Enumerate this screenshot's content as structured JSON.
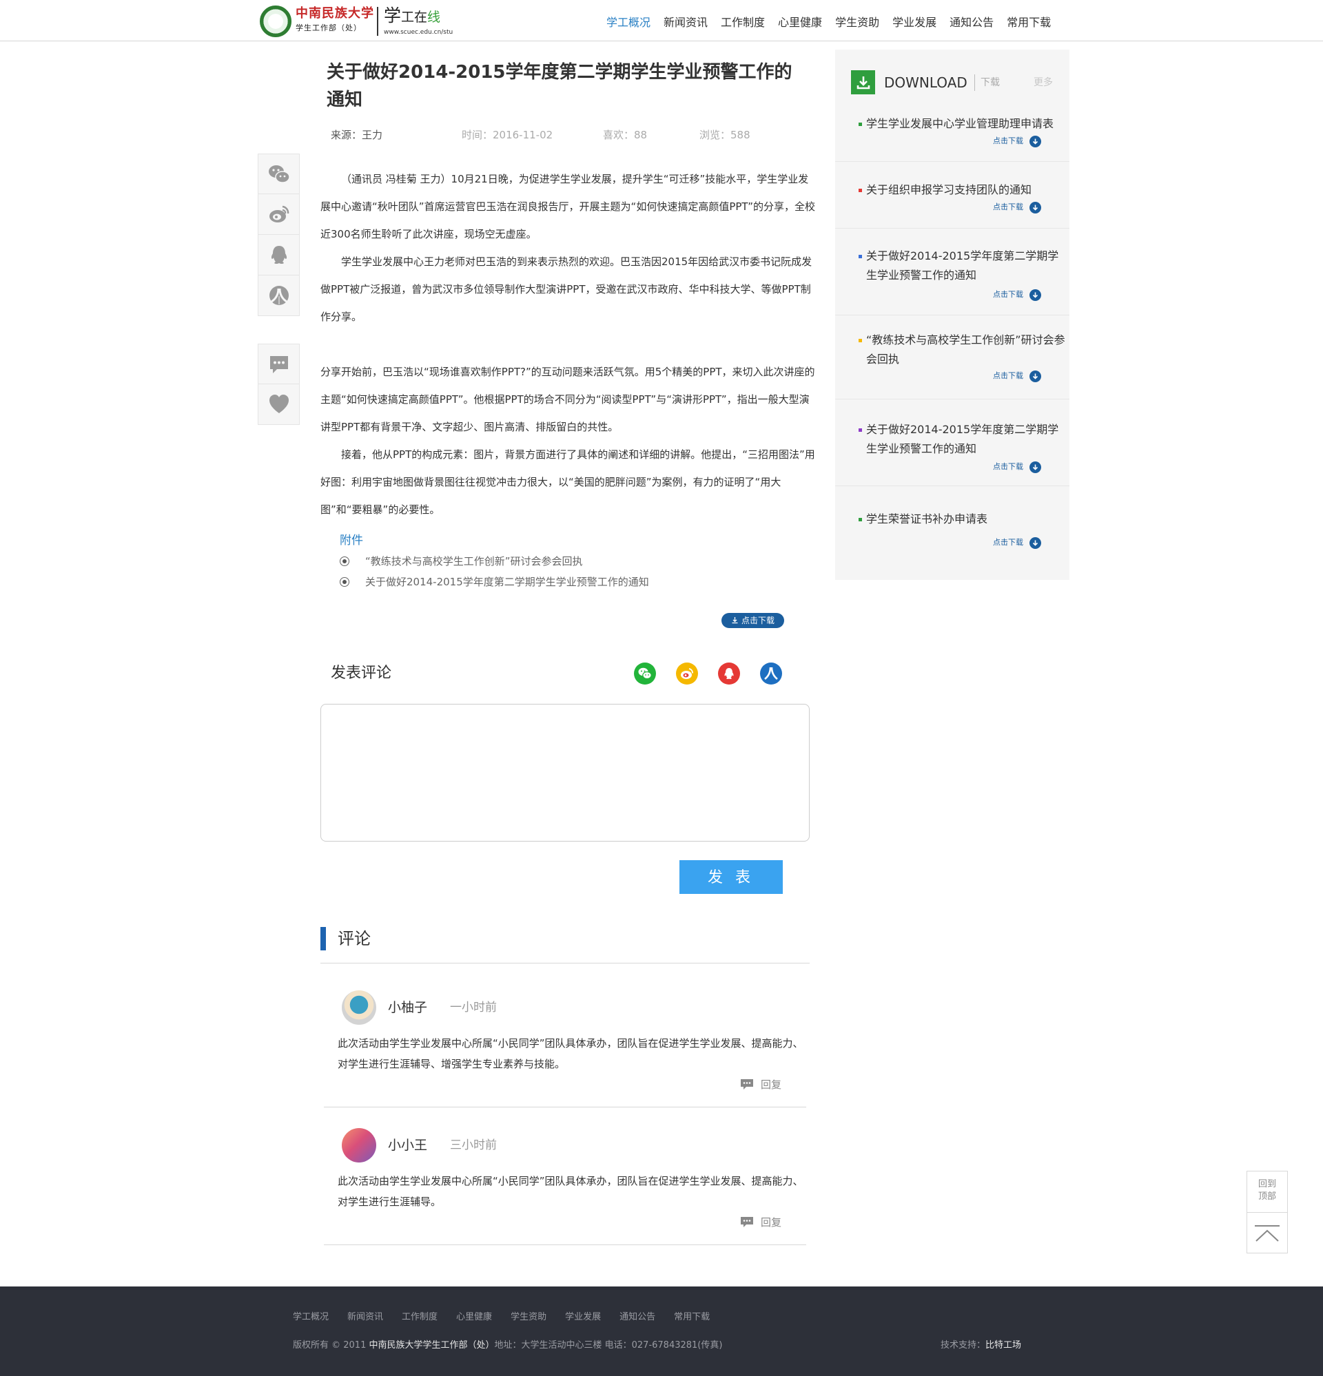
{
  "header": {
    "logo_cn_main": "中南民族大学",
    "logo_cn_sub": "学生工作部（处）",
    "logo_site_a": "学",
    "logo_site_b": "工在",
    "logo_site_c": "线",
    "logo_url": "www.scuec.edu.cn/stu",
    "nav": [
      "学工概况",
      "新闻资讯",
      "工作制度",
      "心里健康",
      "学生资助",
      "学业发展",
      "通知公告",
      "常用下载"
    ]
  },
  "article": {
    "title": "关于做好2014-2015学年度第二学期学生学业预警工作的通知",
    "source": "来源：王力",
    "time": "时间：2016-11-02",
    "likes": "喜欢：88",
    "views": "浏览：588",
    "paragraphs": [
      "（通讯员 冯桂菊 王力）10月21日晚，为促进学生学业发展，提升学生“可迁移”技能水平，学生学业发展中心邀请“秋叶团队”首席运营官巴玉浩在润良报告厅，开展主题为“如何快速搞定高颜值PPT”的分享，全校近300名师生聆听了此次讲座，现场空无虚座。",
      "学生学业发展中心王力老师对巴玉浩的到来表示热烈的欢迎。巴玉浩因2015年因给武汉市委书记阮成发做PPT被广泛报道，曾为武汉市多位领导制作大型演讲PPT，受邀在武汉市政府、华中科技大学、等做PPT制作分享。",
      "分享开始前，巴玉浩以“现场谁喜欢制作PPT?”的互动问题来活跃气氛。用5个精美的PPT，来切入此次讲座的主题“如何快速搞定高颜值PPT”。他根据PPT的场合不同分为“阅读型PPT”与“演讲形PPT”，指出一般大型演讲型PPT都有背景干净、文字超少、图片高清、排版留白的共性。",
      "接着，他从PPT的构成元素：图片，背景方面进行了具体的阐述和详细的讲解。他提出，“三招用图法”用好图：利用宇宙地图做背景图往往视觉冲击力很大，以“美国的肥胖问题”为案例，有力的证明了“用大图”和“要粗暴”的必要性。"
    ],
    "attachments_title": "附件",
    "attachments": [
      "“教练技术与高校学生工作创新”研讨会参会回执",
      "关于做好2014-2015学年度第二学期学生学业预警工作的通知"
    ],
    "download_label": "点击下载"
  },
  "share_rail": {
    "icons": [
      "wechat-icon",
      "weibo-icon",
      "qq-icon",
      "renren-icon",
      "comment-icon",
      "heart-icon"
    ]
  },
  "comment_form": {
    "heading": "发表评论",
    "textarea_value": "",
    "submit_label": "发 表",
    "share_colors": {
      "wechat": "#22b43a",
      "weibo": "#f5b800",
      "qq": "#e53935",
      "renren": "#1e6fc1"
    }
  },
  "comments": {
    "heading": "评论",
    "items": [
      {
        "name": "小柚子",
        "time": "一小时前",
        "text": "此次活动由学生学业发展中心所属“小民同学”团队具体承办，团队旨在促进学生学业发展、提高能力、对学生进行生涯辅导、增强学生专业素养与技能。",
        "reply_label": "回复"
      },
      {
        "name": "小小王",
        "time": "三小时前",
        "text": "此次活动由学生学业发展中心所属“小民同学”团队具体承办，团队旨在促进学生学业发展、提高能力、对学生进行生涯辅导。",
        "reply_label": "回复"
      }
    ]
  },
  "sidebar": {
    "title": "DOWNLOAD",
    "subtitle": "下载",
    "more": "更多",
    "download_label": "点击下载",
    "items": [
      {
        "label": "学生学业发展中心学业管理助理申请表",
        "color": "#2f9e3e"
      },
      {
        "label": "关于组织申报学习支持团队的通知",
        "color": "#e53935"
      },
      {
        "label": "关于做好2014-2015学年度第二学期学生学业预警工作的通知",
        "color": "#3a6fd8"
      },
      {
        "label": "“教练技术与高校学生工作创新”研讨会参会回执",
        "color": "#f5b800"
      },
      {
        "label": "关于做好2014-2015学年度第二学期学生学业预警工作的通知",
        "color": "#8e3cc8"
      },
      {
        "label": "学生荣誉证书补办申请表",
        "color": "#2f9e3e"
      }
    ]
  },
  "backtop": {
    "label": "回到顶部"
  },
  "footer": {
    "nav": [
      "学工概况",
      "新闻资讯",
      "工作制度",
      "心里健康",
      "学生资助",
      "学业发展",
      "通知公告",
      "常用下载"
    ],
    "copyright_prefix": "版权所有 © 2011 ",
    "copyright_org": "中南民族大学学生工作部（处）",
    "copyright_suffix": "地址：大学生活动中心三楼  电话：027-67843281(传真)",
    "tech_label": "技术支持：",
    "tech_name": "比特工场"
  }
}
